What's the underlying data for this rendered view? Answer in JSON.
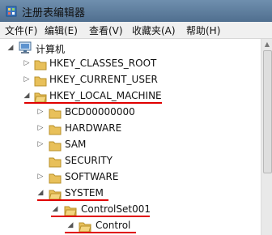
{
  "window": {
    "title": "注册表编辑器"
  },
  "menu": [
    "文件(F)",
    "编辑(E)",
    "查看(V)",
    "收藏夹(A)",
    "帮助(H)"
  ],
  "tree": {
    "root": "计算机",
    "items": [
      "HKEY_CLASSES_ROOT",
      "HKEY_CURRENT_USER",
      "HKEY_LOCAL_MACHINE",
      "BCD00000000",
      "HARDWARE",
      "SAM",
      "SECURITY",
      "SOFTWARE",
      "SYSTEM",
      "ControlSet001",
      "Control"
    ]
  },
  "colors": {
    "highlight_underline": "#e00000",
    "titlebar": "#5a7999",
    "folder": "#e8c05a"
  }
}
